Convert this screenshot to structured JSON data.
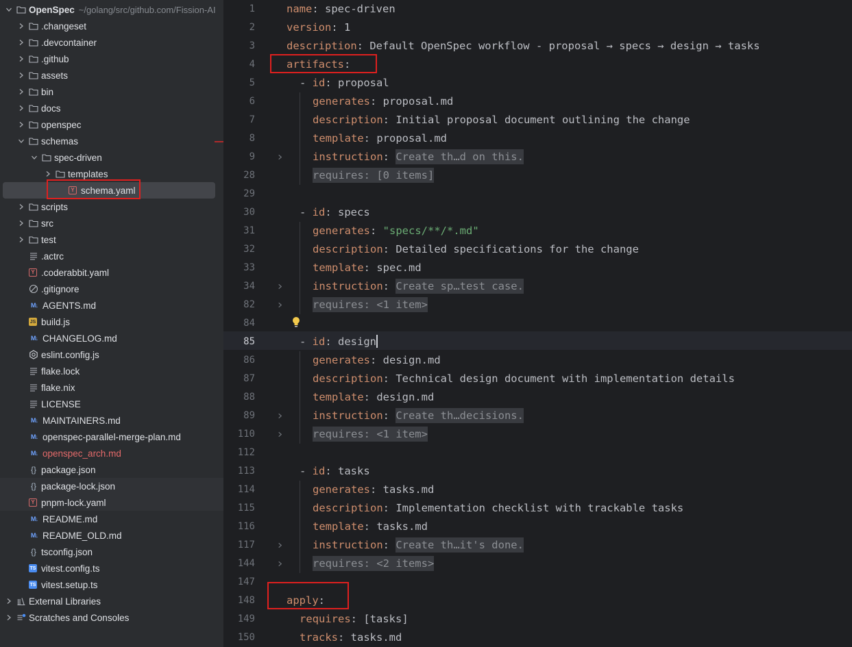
{
  "project": {
    "root_name": "OpenSpec",
    "root_path": "~/golang/src/github.com/Fission-AI"
  },
  "tree": [
    {
      "label": "OpenSpec",
      "icon": "folder-icon",
      "expanded": true
    },
    {
      "label": ".changeset",
      "icon": "folder-icon"
    },
    {
      "label": ".devcontainer",
      "icon": "folder-icon"
    },
    {
      "label": ".github",
      "icon": "folder-icon"
    },
    {
      "label": "assets",
      "icon": "folder-icon"
    },
    {
      "label": "bin",
      "icon": "folder-icon"
    },
    {
      "label": "docs",
      "icon": "folder-icon"
    },
    {
      "label": "openspec",
      "icon": "folder-icon"
    },
    {
      "label": "schemas",
      "icon": "folder-icon",
      "expanded": true
    },
    {
      "label": "spec-driven",
      "icon": "folder-icon",
      "expanded": true
    },
    {
      "label": "templates",
      "icon": "folder-icon"
    },
    {
      "label": "schema.yaml",
      "icon": "yaml-file-icon",
      "selected": true
    },
    {
      "label": "scripts",
      "icon": "folder-icon"
    },
    {
      "label": "src",
      "icon": "folder-icon"
    },
    {
      "label": "test",
      "icon": "folder-icon"
    },
    {
      "label": ".actrc",
      "icon": "text-file-icon"
    },
    {
      "label": ".coderabbit.yaml",
      "icon": "yaml-file-icon"
    },
    {
      "label": ".gitignore",
      "icon": "ignore-file-icon"
    },
    {
      "label": "AGENTS.md",
      "icon": "markdown-file-icon"
    },
    {
      "label": "build.js",
      "icon": "js-file-icon"
    },
    {
      "label": "CHANGELOG.md",
      "icon": "markdown-file-icon"
    },
    {
      "label": "eslint.config.js",
      "icon": "eslint-file-icon"
    },
    {
      "label": "flake.lock",
      "icon": "text-file-icon"
    },
    {
      "label": "flake.nix",
      "icon": "text-file-icon"
    },
    {
      "label": "LICENSE",
      "icon": "text-file-icon"
    },
    {
      "label": "MAINTAINERS.md",
      "icon": "markdown-file-icon"
    },
    {
      "label": "openspec-parallel-merge-plan.md",
      "icon": "markdown-file-icon"
    },
    {
      "label": "openspec_arch.md",
      "icon": "markdown-file-icon",
      "modified": true
    },
    {
      "label": "package.json",
      "icon": "json-file-icon"
    },
    {
      "label": "package-lock.json",
      "icon": "json-file-icon"
    },
    {
      "label": "pnpm-lock.yaml",
      "icon": "yaml-file-icon"
    },
    {
      "label": "README.md",
      "icon": "markdown-file-icon"
    },
    {
      "label": "README_OLD.md",
      "icon": "markdown-file-icon"
    },
    {
      "label": "tsconfig.json",
      "icon": "json-file-icon"
    },
    {
      "label": "vitest.config.ts",
      "icon": "ts-file-icon"
    },
    {
      "label": "vitest.setup.ts",
      "icon": "ts-file-icon"
    },
    {
      "label": "External Libraries",
      "icon": "library-icon"
    },
    {
      "label": "Scratches and Consoles",
      "icon": "scratches-icon"
    }
  ],
  "icon_glyphs": {
    "markdown": "M↓",
    "yaml": "Y",
    "js": "JS",
    "ts": "TS",
    "json": "{}"
  },
  "editor": {
    "active_line": "85",
    "lines": [
      {
        "n": "1",
        "key": "name",
        "sep": ": ",
        "val": "spec-driven"
      },
      {
        "n": "2",
        "key": "version",
        "sep": ": ",
        "val": "1"
      },
      {
        "n": "3",
        "key": "description",
        "sep": ": ",
        "val": "Default OpenSpec workflow - proposal → specs → design → tasks"
      },
      {
        "n": "4",
        "key": "artifacts",
        "sep": ":",
        "val": ""
      },
      {
        "n": "5",
        "dash": "- ",
        "key": "id",
        "sep": ": ",
        "val": "proposal"
      },
      {
        "n": "6",
        "key": "generates",
        "sep": ": ",
        "val": "proposal.md"
      },
      {
        "n": "7",
        "key": "description",
        "sep": ": ",
        "val": "Initial proposal document outlining the change"
      },
      {
        "n": "8",
        "key": "template",
        "sep": ": ",
        "val": "proposal.md"
      },
      {
        "n": "9",
        "key": "instruction",
        "sep": ": ",
        "collapsed": "Create th…d on this.",
        "fold": true
      },
      {
        "n": "28",
        "collapsed_full": "requires: [0 items]"
      },
      {
        "n": "29"
      },
      {
        "n": "30",
        "dash": "- ",
        "key": "id",
        "sep": ": ",
        "val": "specs"
      },
      {
        "n": "31",
        "key": "generates",
        "sep": ": ",
        "str": "\"specs/**/*.md\""
      },
      {
        "n": "32",
        "key": "description",
        "sep": ": ",
        "val": "Detailed specifications for the change"
      },
      {
        "n": "33",
        "key": "template",
        "sep": ": ",
        "val": "spec.md"
      },
      {
        "n": "34",
        "key": "instruction",
        "sep": ": ",
        "collapsed": "Create sp…test case.",
        "fold": true
      },
      {
        "n": "82",
        "collapsed_full": "requires: <1 item>",
        "fold": true
      },
      {
        "n": "84"
      },
      {
        "n": "85",
        "dash": "- ",
        "key": "id",
        "sep": ": ",
        "val": "design",
        "caret": true
      },
      {
        "n": "86",
        "key": "generates",
        "sep": ": ",
        "val": "design.md"
      },
      {
        "n": "87",
        "key": "description",
        "sep": ": ",
        "val": "Technical design document with implementation details"
      },
      {
        "n": "88",
        "key": "template",
        "sep": ": ",
        "val": "design.md"
      },
      {
        "n": "89",
        "key": "instruction",
        "sep": ": ",
        "collapsed": "Create th…decisions.",
        "fold": true
      },
      {
        "n": "110",
        "collapsed_full": "requires: <1 item>",
        "fold": true
      },
      {
        "n": "112"
      },
      {
        "n": "113",
        "dash": "- ",
        "key": "id",
        "sep": ": ",
        "val": "tasks"
      },
      {
        "n": "114",
        "key": "generates",
        "sep": ": ",
        "val": "tasks.md"
      },
      {
        "n": "115",
        "key": "description",
        "sep": ": ",
        "val": "Implementation checklist with trackable tasks"
      },
      {
        "n": "116",
        "key": "template",
        "sep": ": ",
        "val": "tasks.md"
      },
      {
        "n": "117",
        "key": "instruction",
        "sep": ": ",
        "collapsed": "Create th…it's done.",
        "fold": true
      },
      {
        "n": "144",
        "collapsed_full": "requires: <2 items>",
        "fold": true
      },
      {
        "n": "147"
      },
      {
        "n": "148",
        "key": "apply",
        "sep": ":",
        "val": ""
      },
      {
        "n": "149",
        "key": "requires",
        "sep": ": ",
        "val": "[tasks]"
      },
      {
        "n": "150",
        "key": "tracks",
        "sep": ": ",
        "val": "tasks.md"
      }
    ]
  },
  "colors": {
    "sidebar_bg": "#2b2d30",
    "editor_bg": "#1e1f22",
    "yaml_key": "#cf8e6d",
    "yaml_string": "#6aab73",
    "annotation_box": "#e0201f"
  }
}
